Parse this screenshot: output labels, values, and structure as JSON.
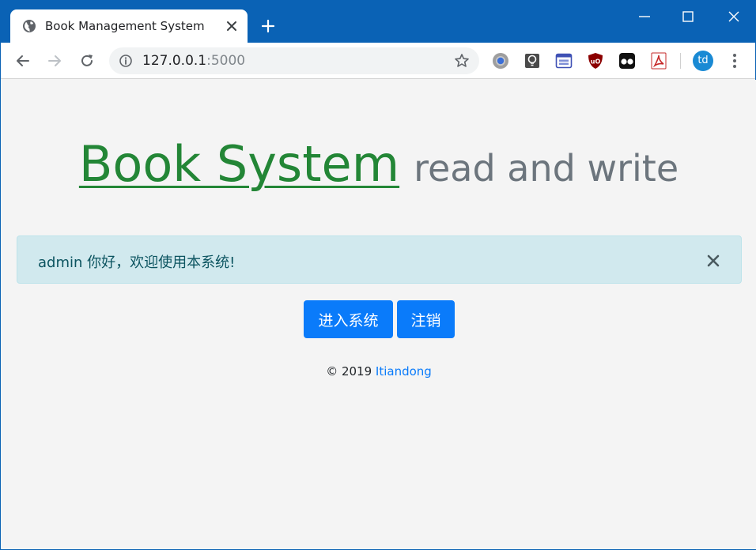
{
  "browser": {
    "tab": {
      "title": "Book Management System"
    },
    "address": {
      "host": "127.0.0.1",
      "port": ":5000"
    },
    "profile": {
      "initials": "td"
    }
  },
  "page": {
    "heading": {
      "brand": "Book System",
      "subtitle": "read and write"
    },
    "alert": {
      "message": "admin 你好，欢迎使用本系统!"
    },
    "buttons": {
      "enter": "进入系统",
      "logout": "注销"
    },
    "footer": {
      "copyright": "© 2019 ",
      "author": "Itiandong"
    }
  },
  "colors": {
    "chrome_blue": "#0a62b5",
    "brand_green": "#238636",
    "subtitle_gray": "#6c757d",
    "alert_bg": "#d1e9ee",
    "alert_text": "#0c5460",
    "button_blue": "#0a7bfa"
  },
  "icons": {
    "favicon": "globe-icon",
    "tab_close": "close-icon",
    "new_tab": "plus-icon",
    "back": "arrow-left-icon",
    "forward": "arrow-right-icon",
    "reload": "reload-icon",
    "site_info": "info-icon",
    "bookmark": "star-icon",
    "menu": "more-vert-icon"
  }
}
